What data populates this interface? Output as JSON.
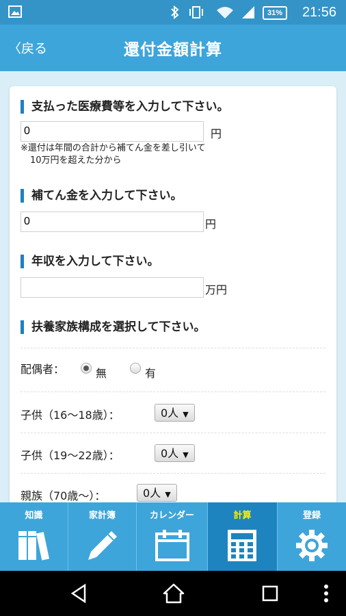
{
  "status": {
    "battery": "31%",
    "time": "21:56"
  },
  "header": {
    "back_label": "〈戻る",
    "title": "還付金額計算"
  },
  "form": {
    "medical": {
      "label": "支払った医療費等を入力して下さい。",
      "value": "0",
      "unit": "円",
      "note_line1": "※還付は年間の合計から補てん金を差し引いて",
      "note_line2": "10万円を超えた分から"
    },
    "compensation": {
      "label": "補てん金を入力して下さい。",
      "value": "0",
      "unit": "円"
    },
    "income": {
      "label": "年収を入力して下さい。",
      "value": "",
      "unit": "万円"
    },
    "family": {
      "label": "扶養家族構成を選択して下さい。",
      "spouse": {
        "label": "配偶者：",
        "options": [
          "無",
          "有"
        ],
        "selected": "無"
      },
      "child1": {
        "label": "子供（16〜18歳）：",
        "value": "0人"
      },
      "child2": {
        "label": "子供（19〜22歳）：",
        "value": "0人"
      },
      "relative": {
        "label": "親族（70歳〜）：",
        "value": "0人"
      }
    }
  },
  "tabs": [
    {
      "label": "知識",
      "icon": "books-icon"
    },
    {
      "label": "家計簿",
      "icon": "pencil-icon"
    },
    {
      "label": "カレンダー",
      "icon": "calendar-icon"
    },
    {
      "label": "計算",
      "icon": "calculator-icon",
      "active": true
    },
    {
      "label": "登録",
      "icon": "gear-icon"
    }
  ],
  "colors": {
    "header": "#3ea5da",
    "active_tab": "#1e84bf",
    "active_tab_text": "#ffee00",
    "accent_bar": "#1f7fc0"
  }
}
